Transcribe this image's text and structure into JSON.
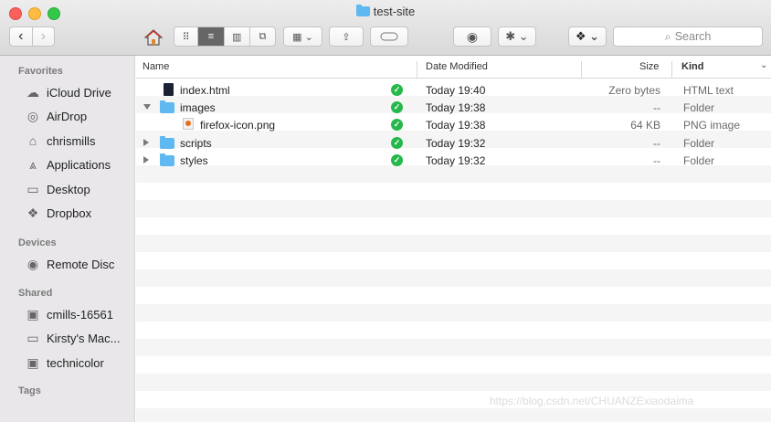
{
  "window": {
    "title": "test-site"
  },
  "toolbar": {
    "back_icon": "‹",
    "forward_icon": "›",
    "home_icon": "home-icon",
    "search_placeholder": "Search"
  },
  "sidebar": {
    "favorites_label": "Favorites",
    "favorites": [
      {
        "label": "iCloud Drive",
        "icon": "cloud-icon"
      },
      {
        "label": "AirDrop",
        "icon": "airdrop-icon"
      },
      {
        "label": "chrismills",
        "icon": "home-icon"
      },
      {
        "label": "Applications",
        "icon": "applications-icon"
      },
      {
        "label": "Desktop",
        "icon": "desktop-icon"
      },
      {
        "label": "Dropbox",
        "icon": "dropbox-icon"
      }
    ],
    "devices_label": "Devices",
    "devices": [
      {
        "label": "Remote Disc",
        "icon": "disc-icon"
      }
    ],
    "shared_label": "Shared",
    "shared": [
      {
        "label": "cmills-16561",
        "icon": "computer-icon"
      },
      {
        "label": "Kirsty's Mac...",
        "icon": "computer-icon"
      },
      {
        "label": "technicolor",
        "icon": "computer-icon"
      }
    ],
    "tags_label": "Tags"
  },
  "columns": {
    "name": "Name",
    "date": "Date Modified",
    "size": "Size",
    "kind": "Kind"
  },
  "files": [
    {
      "name": "index.html",
      "date": "Today 19:40",
      "size": "Zero bytes",
      "kind": "HTML text",
      "icon": "html-file-icon"
    },
    {
      "name": "images",
      "date": "Today 19:38",
      "size": "--",
      "kind": "Folder",
      "icon": "folder-icon"
    },
    {
      "name": "firefox-icon.png",
      "date": "Today 19:38",
      "size": "64 KB",
      "kind": "PNG image",
      "icon": "png-file-icon"
    },
    {
      "name": "scripts",
      "date": "Today 19:32",
      "size": "--",
      "kind": "Folder",
      "icon": "folder-icon"
    },
    {
      "name": "styles",
      "date": "Today 19:32",
      "size": "--",
      "kind": "Folder",
      "icon": "folder-icon"
    }
  ],
  "watermark": "https://blog.csdn.net/CHUANZExiaodaima"
}
